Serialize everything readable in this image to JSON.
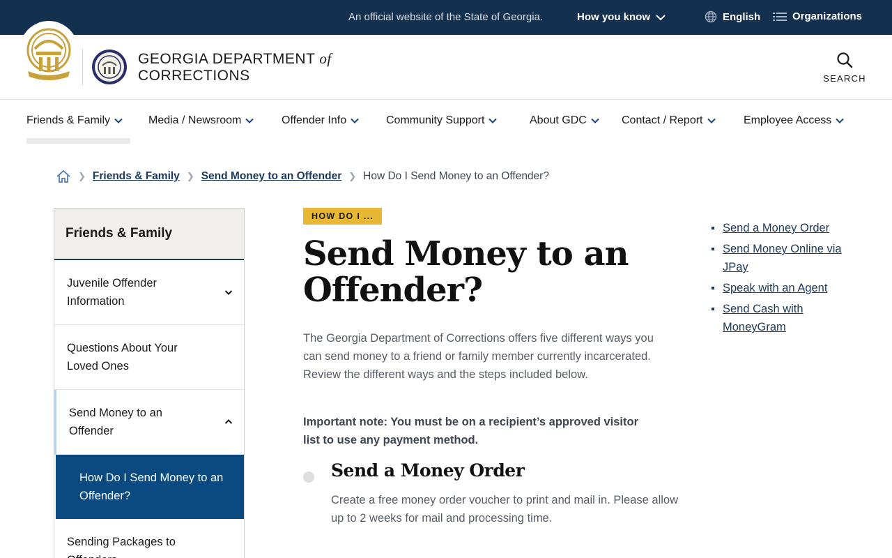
{
  "banner": {
    "official_text": "An official website of the State of Georgia.",
    "how_you_know": "How you know",
    "language": "English",
    "organizations": "Organizations"
  },
  "header": {
    "agency_line1": "GEORGIA DEPARTMENT",
    "agency_of": "of",
    "agency_line2": "CORRECTIONS",
    "search_label": "SEARCH"
  },
  "nav": {
    "items": [
      {
        "label": "Friends & Family"
      },
      {
        "label": "Media / Newsroom"
      },
      {
        "label": "Offender Info"
      },
      {
        "label": "Community Support"
      },
      {
        "label": "About GDC"
      },
      {
        "label": "Contact / Report"
      },
      {
        "label": "Employee Access"
      }
    ]
  },
  "breadcrumb": {
    "items": [
      "Friends & Family",
      "Send Money to an Offender"
    ],
    "current": "How Do I Send Money to an Offender?"
  },
  "sidenav": {
    "heading": "Friends & Family",
    "items": [
      {
        "label": "Juvenile Offender Information"
      },
      {
        "label": "Questions About Your Loved Ones"
      },
      {
        "label": "Send Money to an Offender"
      },
      {
        "label": "Sending Packages to Offenders"
      }
    ],
    "active_sub": "How Do I Send Money to an Offender?"
  },
  "main": {
    "kicker": "HOW DO I ...",
    "title": "Send Money to an Offender?",
    "intro": "The Georgia Department of Corrections offers five different ways you can send money to a friend or family member currently incarcerated. Review the different ways and the steps included below.",
    "note": "Important note: You must be on a recipient’s approved visitor list to use any payment method.",
    "step_title": "Send a Money Order",
    "step_desc": "Create a free money order voucher to print and mail in. Please allow up to 2 weeks for mail and processing time."
  },
  "toc": {
    "links": [
      "Send a Money Order",
      "Send Money Online via JPay",
      "Speak with an Agent",
      "Send Cash with MoneyGram"
    ]
  },
  "colors": {
    "banner_bg": "#13304f",
    "accent_blue": "#0b4a80",
    "kicker_gold": "#e8b834",
    "link": "#1b3a5c"
  }
}
